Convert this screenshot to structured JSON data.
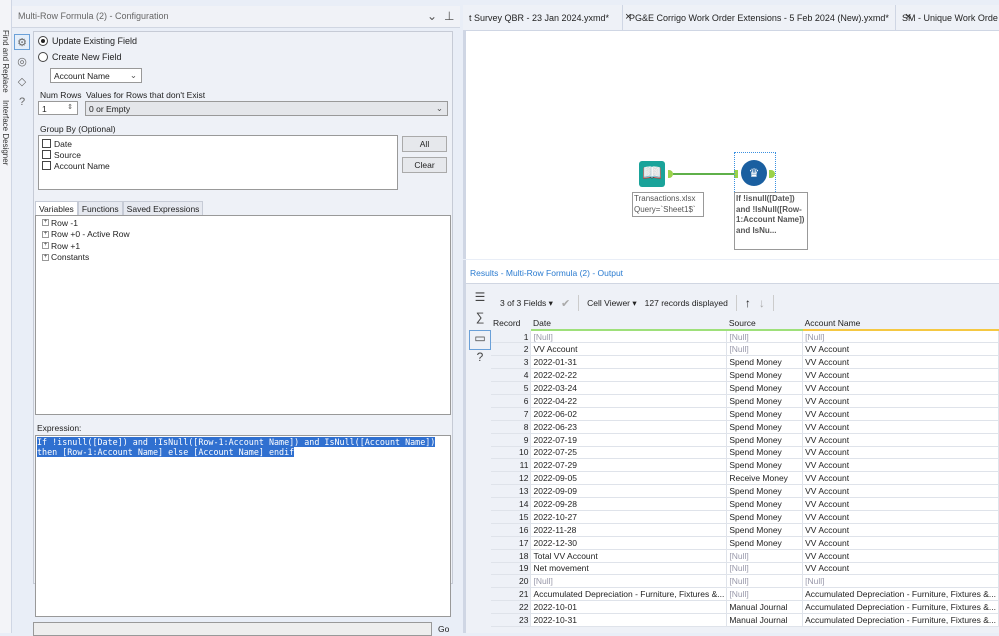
{
  "side_strip": [
    "Find and Replace",
    "Interface Designer"
  ],
  "config": {
    "title": "Multi-Row Formula (2) - Configuration",
    "update_existing": "Update Existing Field",
    "create_new": "Create New  Field",
    "field_select": "Account Name",
    "num_rows_label": "Num Rows",
    "num_rows": "1",
    "values_label": "Values for Rows that don't Exist",
    "values_select": "0 or Empty",
    "group_by_label": "Group By (Optional)",
    "group_by": [
      "Date",
      "Source",
      "Account Name"
    ],
    "all_btn": "All",
    "clear_btn": "Clear",
    "tabs": [
      "Variables",
      "Functions",
      "Saved Expressions"
    ],
    "tree": [
      "Row -1",
      "Row +0 - Active Row",
      "Row +1",
      "Constants"
    ],
    "expression_label": "Expression:",
    "expression": [
      "If !isnull([Date]) and !IsNull([Row-1:Account Name]) and IsNull([Account Name])",
      "then [Row-1:Account Name] else [Account Name] endif"
    ],
    "go": "Go"
  },
  "doc_tabs": [
    "t Survey QBR - 23 Jan 2024.yxmd*",
    "PG&E Corrigo Work Order Extensions - 5 Feb 2024 (New).yxmd*",
    "SM - Unique Work Orde"
  ],
  "canvas": {
    "input_label": [
      "Transactions.xlsx",
      "Query=`Sheet1$`"
    ],
    "formula_label": [
      "If !isnull([Date])",
      "and !IsNull([Row-",
      "1:Account Name])",
      "and IsNu..."
    ]
  },
  "results": {
    "title": "Results - Multi-Row Formula (2) - Output",
    "fields": "3 of 3 Fields",
    "viewer": "Cell Viewer",
    "records": "127 records displayed",
    "columns": [
      "Record",
      "Date",
      "Source",
      "Account Name"
    ],
    "rows": [
      [
        "1",
        "[Null]",
        "[Null]",
        "[Null]"
      ],
      [
        "2",
        "VV Account",
        "[Null]",
        "VV Account"
      ],
      [
        "3",
        "2022-01-31",
        "Spend Money",
        "VV Account"
      ],
      [
        "4",
        "2022-02-22",
        "Spend Money",
        "VV Account"
      ],
      [
        "5",
        "2022-03-24",
        "Spend Money",
        "VV Account"
      ],
      [
        "6",
        "2022-04-22",
        "Spend Money",
        "VV Account"
      ],
      [
        "7",
        "2022-06-02",
        "Spend Money",
        "VV Account"
      ],
      [
        "8",
        "2022-06-23",
        "Spend Money",
        "VV Account"
      ],
      [
        "9",
        "2022-07-19",
        "Spend Money",
        "VV Account"
      ],
      [
        "10",
        "2022-07-25",
        "Spend Money",
        "VV Account"
      ],
      [
        "11",
        "2022-07-29",
        "Spend Money",
        "VV Account"
      ],
      [
        "12",
        "2022-09-05",
        "Receive Money",
        "VV Account"
      ],
      [
        "13",
        "2022-09-09",
        "Spend Money",
        "VV Account"
      ],
      [
        "14",
        "2022-09-28",
        "Spend Money",
        "VV Account"
      ],
      [
        "15",
        "2022-10-27",
        "Spend Money",
        "VV Account"
      ],
      [
        "16",
        "2022-11-28",
        "Spend Money",
        "VV Account"
      ],
      [
        "17",
        "2022-12-30",
        "Spend Money",
        "VV Account"
      ],
      [
        "18",
        "Total VV Account",
        "[Null]",
        "VV Account"
      ],
      [
        "19",
        "Net movement",
        "[Null]",
        "VV Account"
      ],
      [
        "20",
        "[Null]",
        "[Null]",
        "[Null]"
      ],
      [
        "21",
        "Accumulated Depreciation - Furniture, Fixtures &...",
        "[Null]",
        "Accumulated Depreciation - Furniture, Fixtures &..."
      ],
      [
        "22",
        "2022-10-01",
        "Manual Journal",
        "Accumulated Depreciation - Furniture, Fixtures &..."
      ],
      [
        "23",
        "2022-10-31",
        "Manual Journal",
        "Accumulated Depreciation - Furniture, Fixtures &..."
      ]
    ]
  },
  "colors": {
    "accent": "#2a7bd0",
    "selection": "#3070d0",
    "input_tool": "#1aa39a",
    "formula_tool": "#1a5fa0",
    "connector": "#9bd24a"
  }
}
